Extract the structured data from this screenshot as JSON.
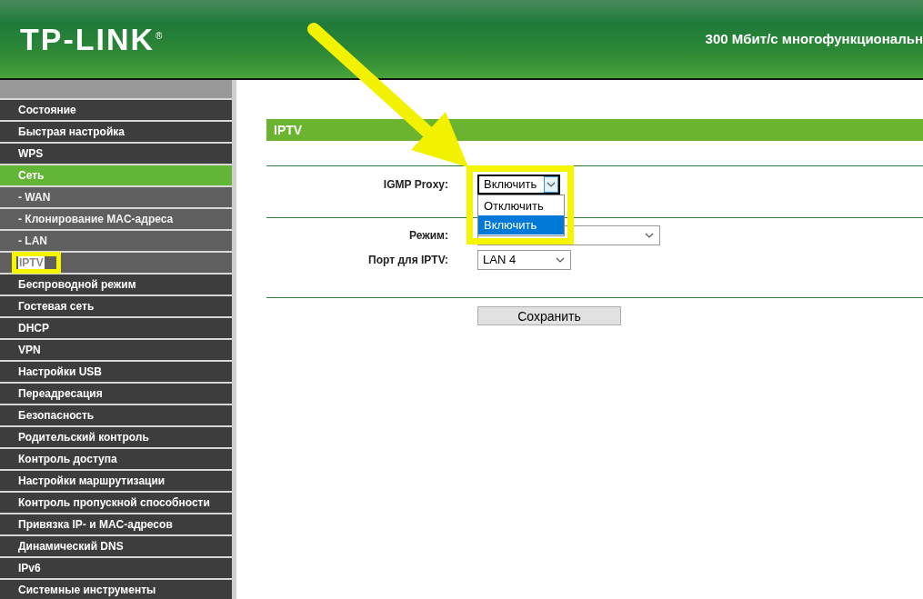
{
  "header": {
    "logo": "TP-LINK",
    "logo_mark": "®",
    "tagline": "300 Мбит/с многофункциональн"
  },
  "sidebar": {
    "items": [
      {
        "label": "Состояние",
        "kind": "main",
        "selected": false
      },
      {
        "label": "Быстрая настройка",
        "kind": "main",
        "selected": false
      },
      {
        "label": "WPS",
        "kind": "main",
        "selected": false
      },
      {
        "label": "Сеть",
        "kind": "main",
        "selected": true
      },
      {
        "label": "- WAN",
        "kind": "sub",
        "selected": false
      },
      {
        "label": "- Клонирование MAC-адреса",
        "kind": "sub",
        "selected": false
      },
      {
        "label": "- LAN",
        "kind": "sub",
        "selected": false
      },
      {
        "label": "IPTV",
        "kind": "sub",
        "selected": false,
        "text_highlighted": true
      },
      {
        "label": "Беспроводной режим",
        "kind": "main",
        "selected": false
      },
      {
        "label": "Гостевая сеть",
        "kind": "main",
        "selected": false
      },
      {
        "label": "DHCP",
        "kind": "main",
        "selected": false
      },
      {
        "label": "VPN",
        "kind": "main",
        "selected": false
      },
      {
        "label": "Настройки USB",
        "kind": "main",
        "selected": false
      },
      {
        "label": "Переадресация",
        "kind": "main",
        "selected": false
      },
      {
        "label": "Безопасность",
        "kind": "main",
        "selected": false
      },
      {
        "label": "Родительский контроль",
        "kind": "main",
        "selected": false
      },
      {
        "label": "Контроль доступа",
        "kind": "main",
        "selected": false
      },
      {
        "label": "Настройки маршрутизации",
        "kind": "main",
        "selected": false
      },
      {
        "label": "Контроль пропускной способности",
        "kind": "main",
        "selected": false
      },
      {
        "label": "Привязка IP- и MAC-адресов",
        "kind": "main",
        "selected": false
      },
      {
        "label": "Динамический DNS",
        "kind": "main",
        "selected": false
      },
      {
        "label": "IPv6",
        "kind": "main",
        "selected": false
      },
      {
        "label": "Системные инструменты",
        "kind": "main",
        "selected": false
      }
    ]
  },
  "section": {
    "title": "IPTV",
    "groups": [
      [
        {
          "label": "IGMP Proxy:",
          "value": "Включить",
          "expanded": true,
          "options": [
            {
              "label": "Отключить",
              "selected": false
            },
            {
              "label": "Включить",
              "selected": true
            }
          ]
        }
      ],
      [
        {
          "label": "Режим:",
          "expanded": false
        },
        {
          "label": "Порт для IPTV:",
          "value": "LAN 4",
          "expanded": false
        }
      ]
    ],
    "save_button": "Сохранить"
  }
}
